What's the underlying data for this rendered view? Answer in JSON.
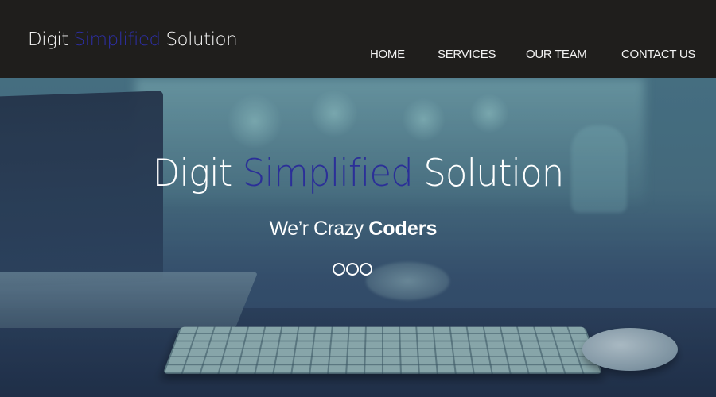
{
  "header": {
    "logo": {
      "part1": "Digit ",
      "part2": "Simplified",
      "part3": " Solution"
    },
    "nav": [
      "HOME",
      "SERVICES",
      "OUR TEAM",
      "CONTACT US"
    ]
  },
  "hero": {
    "title": {
      "part1": "Digit ",
      "part2": "Simplified",
      "part3": " Solution"
    },
    "tagline": {
      "light": "We’r Crazy ",
      "bold": "Coders"
    },
    "slider": {
      "dot_count": 3
    }
  },
  "colors": {
    "header_bg": "#1f1e1c",
    "accent": "#2d2fa8",
    "text": "#ffffff"
  }
}
